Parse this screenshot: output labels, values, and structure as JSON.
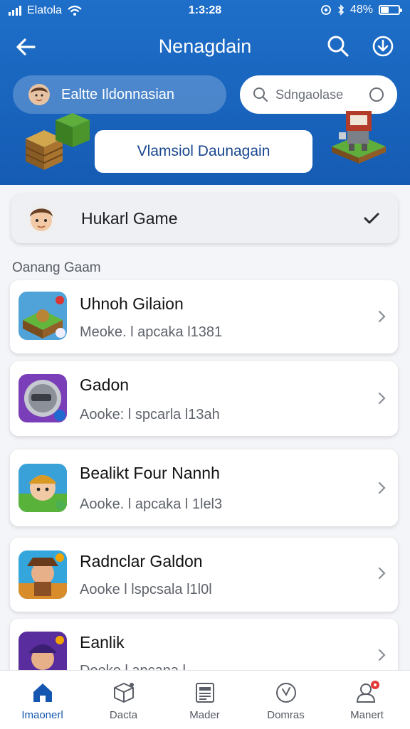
{
  "status_bar": {
    "carrier": "Elatola",
    "time": "1:3:28",
    "battery": "48%",
    "battery_level": 0.48
  },
  "header": {
    "title": "Nenagdain",
    "user_chip_label": "Ealtte Ildonnasian",
    "search_placeholder": "Sdngaolase",
    "banner_button_label": "Vlamsiol Daunagain"
  },
  "featured": {
    "label": "Hukarl Game"
  },
  "section_label": "Oanang Gaam",
  "games": [
    {
      "name": "Uhnoh Gilaion",
      "meta": "Meoke. l apcaka l1381"
    },
    {
      "name": "Gadon",
      "meta": "Aooke: l spcarla l13ah"
    },
    {
      "name": "Bealikt Four Nannh",
      "meta": "Aooke. l apcaka l 1lel3"
    },
    {
      "name": "Radnclar Galdon",
      "meta": "Aooke l lspcsala l1l0l"
    },
    {
      "name": "Eanlik",
      "meta": "Dooke l apcana l"
    }
  ],
  "tabs": [
    {
      "label": "Imaonerl",
      "icon": "home-icon",
      "active": true
    },
    {
      "label": "Dacta",
      "icon": "box-icon",
      "active": false
    },
    {
      "label": "Mader",
      "icon": "newspaper-icon",
      "active": false
    },
    {
      "label": "Domras",
      "icon": "compass-icon",
      "active": false
    },
    {
      "label": "Manert",
      "icon": "profile-icon",
      "active": false
    }
  ],
  "colors": {
    "header": "#1e6fc9",
    "accent": "#1557b0",
    "badge": "#e53935"
  }
}
